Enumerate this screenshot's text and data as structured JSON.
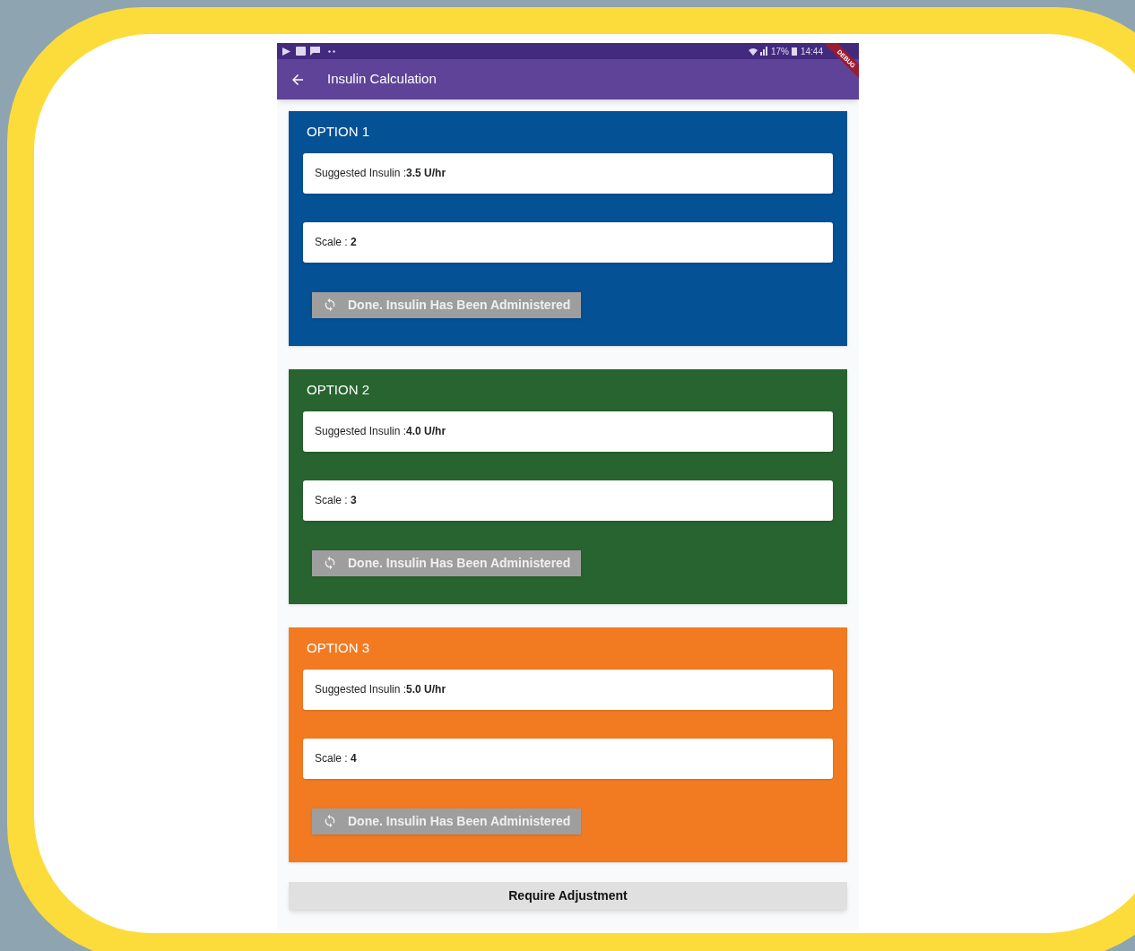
{
  "status_bar": {
    "battery": "17%",
    "time": "14:44",
    "debug_banner": "DEBUG"
  },
  "app_bar": {
    "title": "Insulin Calculation"
  },
  "options": [
    {
      "title": "OPTION 1",
      "color": "#055195",
      "insulin": "Suggested Insulin :**3.5 U/hr**",
      "scale": "Scale : **2**",
      "button": {
        "label": "Done. Insulin Has Been Administered",
        "disabled": true
      }
    },
    {
      "title": "OPTION 2",
      "color": "#27642f",
      "insulin": "Suggested Insulin :**4.0 U/hr**",
      "scale": "Scale : **3**",
      "button": {
        "label": "Done. Insulin Has Been Administered",
        "disabled": true
      }
    },
    {
      "title": "OPTION 3",
      "color": "#f27b22",
      "insulin": "Suggested Insulin :**5.0 U/hr**",
      "scale": "Scale : **4**",
      "button": {
        "label": "Done. Insulin Has Been Administered",
        "disabled": true
      }
    }
  ],
  "adjust_button": "Require Adjustment"
}
